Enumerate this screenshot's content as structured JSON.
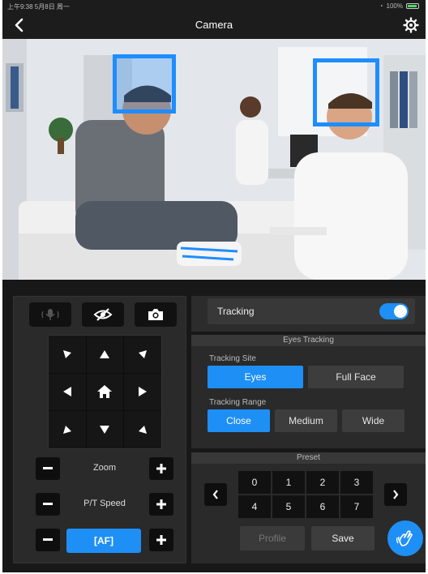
{
  "status_bar": {
    "time": "上午9:38 5月8日 周一",
    "battery": "100%"
  },
  "nav": {
    "title": "Camera",
    "back_icon": "chevron-left-icon",
    "settings_icon": "gear-icon"
  },
  "tracking": {
    "label": "Tracking",
    "enabled": true
  },
  "eyes_tracking": {
    "title": "Eyes Tracking",
    "site_label": "Tracking Site",
    "site_options": [
      "Eyes",
      "Full Face"
    ],
    "site_selected": "Eyes",
    "range_label": "Tracking Range",
    "range_options": [
      "Close",
      "Medium",
      "Wide"
    ],
    "range_selected": "Close"
  },
  "preset": {
    "title": "Preset",
    "numbers": [
      "0",
      "1",
      "2",
      "3",
      "4",
      "5",
      "6",
      "7"
    ],
    "profile_label": "Profile",
    "save_label": "Save"
  },
  "controls": {
    "zoom_label": "Zoom",
    "pt_speed_label": "P/T Speed",
    "af_label": "[AF]"
  },
  "colors": {
    "accent": "#1e8ff5",
    "face_box": "#1e8dff",
    "background": "#1c1c1c"
  }
}
